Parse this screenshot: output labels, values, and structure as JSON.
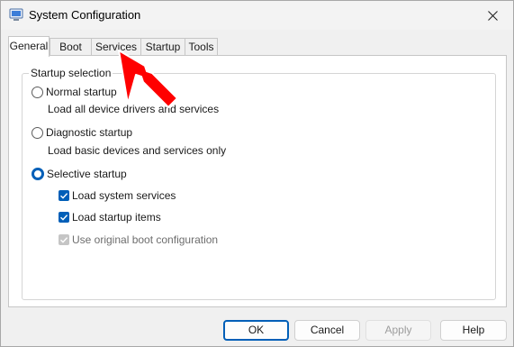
{
  "window": {
    "title": "System Configuration",
    "icon": "msconfig-icon",
    "close_glyph": "✕"
  },
  "tabs": [
    {
      "label": "General",
      "active": true
    },
    {
      "label": "Boot",
      "active": false
    },
    {
      "label": "Services",
      "active": false
    },
    {
      "label": "Startup",
      "active": false
    },
    {
      "label": "Tools",
      "active": false
    }
  ],
  "startup_selection": {
    "group_label": "Startup selection",
    "normal": {
      "label": "Normal startup",
      "description": "Load all device drivers and services",
      "selected": false
    },
    "diagnostic": {
      "label": "Diagnostic startup",
      "description": "Load basic devices and services only",
      "selected": false
    },
    "selective": {
      "label": "Selective startup",
      "selected": true,
      "options": [
        {
          "label": "Load system services",
          "checked": true,
          "enabled": true
        },
        {
          "label": "Load startup items",
          "checked": true,
          "enabled": true
        },
        {
          "label": "Use original boot configuration",
          "checked": true,
          "enabled": false
        }
      ]
    }
  },
  "buttons": {
    "ok": "OK",
    "cancel": "Cancel",
    "apply": "Apply",
    "help": "Help"
  },
  "colors": {
    "accent": "#005fb8",
    "annotation_arrow": "#ff0000"
  }
}
